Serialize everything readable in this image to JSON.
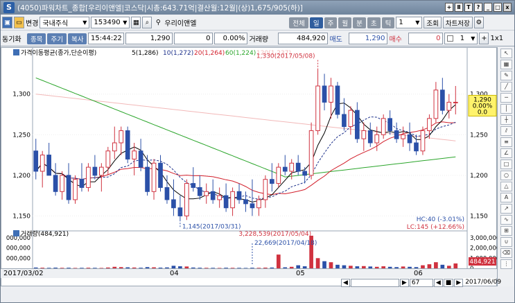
{
  "title": {
    "app_icon": "S",
    "text": "(4050)파워차트_종합[우리이앤엘|코스닥|시총:643.71억|결산월:12월|(상)1,675/905(하)]",
    "buttons": [
      "+",
      "Ⅱ",
      "T",
      "?",
      "_",
      "□",
      "x"
    ]
  },
  "toolbar1": {
    "change_label": "변경",
    "market": "국내주식",
    "code": "153490",
    "stock_name": "우리이앤엘",
    "view_buttons": [
      "전체",
      "일",
      "주",
      "월",
      "분",
      "초",
      "틱"
    ],
    "view_selected": "일",
    "period_value": "1",
    "query_button": "조회",
    "save_button": "차트저장"
  },
  "toolbar2": {
    "sync_label": "동기화",
    "tabs": [
      "종목",
      "주기",
      "복사"
    ],
    "time": "15:44:22",
    "price": "1,290",
    "change": "0",
    "change_pct": "0.00%",
    "volume_label": "거래량",
    "volume": "484,920",
    "ask_label": "매도",
    "ask": "1,290",
    "bid_label": "매수",
    "bid": "0",
    "count": "1",
    "ratio_label": "1x1"
  },
  "legend": {
    "ma_title": "가격이동평균(종가,단순이평)",
    "ma5": "5(1,286)",
    "ma10": "10(1,272)",
    "ma20": "20(1,264)",
    "ma60": "60(1,224)",
    "ma120": "120(1,237)",
    "volume_title": "거래량(484,921)"
  },
  "annotations": {
    "high": "1,330(2017/05/08)",
    "low": "1,145(2017/03/31)",
    "vol_high": "3,228,539(2017/05/04)",
    "vol_low": "22,669(2017/04/18)",
    "hc": "HC:40 (-3.01%)",
    "lc": "LC:145 (+12.66%)",
    "last_price": "1,290",
    "last_pct": "0.00%",
    "last_chg": "0.0",
    "last_vol": "484,921"
  },
  "axis": {
    "price_ticks": [
      "1,300",
      "1,250",
      "1,200",
      "1,150"
    ],
    "vol_ticks": [
      "3,000,000",
      "2,000,000",
      "1,000,000",
      "0"
    ],
    "left_vol_ticks": [
      "000,000",
      "000,000",
      "000,000"
    ],
    "dates": [
      "2017/03/02",
      "04",
      "05",
      "06",
      "2017/06/09"
    ]
  },
  "bottom": {
    "zoom": "67"
  },
  "colors": {
    "up": "#d0323f",
    "down": "#2b50a8",
    "ma5": "#000000",
    "ma10": "#1b2f8a",
    "ma20": "#d21e2a",
    "ma60": "#2aa52a",
    "ma120": "#f2b8b8"
  },
  "chart_data": {
    "type": "candlestick",
    "ylim": [
      1135,
      1345
    ],
    "candles": [
      [
        1230,
        1245,
        1195,
        1205
      ],
      [
        1205,
        1230,
        1185,
        1225
      ],
      [
        1225,
        1240,
        1200,
        1200
      ],
      [
        1200,
        1215,
        1175,
        1180
      ],
      [
        1180,
        1205,
        1170,
        1200
      ],
      [
        1200,
        1215,
        1165,
        1170
      ],
      [
        1170,
        1200,
        1165,
        1195
      ],
      [
        1195,
        1215,
        1180,
        1185
      ],
      [
        1185,
        1215,
        1180,
        1210
      ],
      [
        1210,
        1225,
        1195,
        1200
      ],
      [
        1200,
        1215,
        1180,
        1210
      ],
      [
        1210,
        1235,
        1200,
        1230
      ],
      [
        1230,
        1260,
        1220,
        1240
      ],
      [
        1240,
        1260,
        1225,
        1255
      ],
      [
        1255,
        1260,
        1215,
        1220
      ],
      [
        1220,
        1240,
        1200,
        1230
      ],
      [
        1230,
        1245,
        1205,
        1210
      ],
      [
        1210,
        1225,
        1175,
        1180
      ],
      [
        1180,
        1220,
        1170,
        1215
      ],
      [
        1215,
        1225,
        1180,
        1185
      ],
      [
        1185,
        1200,
        1165,
        1170
      ],
      [
        1170,
        1195,
        1150,
        1160
      ],
      [
        1160,
        1175,
        1145,
        1150
      ],
      [
        1150,
        1195,
        1145,
        1190
      ],
      [
        1190,
        1210,
        1180,
        1185
      ],
      [
        1185,
        1200,
        1170,
        1175
      ],
      [
        1175,
        1190,
        1165,
        1180
      ],
      [
        1180,
        1195,
        1165,
        1170
      ],
      [
        1170,
        1185,
        1160,
        1175
      ],
      [
        1175,
        1190,
        1155,
        1160
      ],
      [
        1160,
        1185,
        1150,
        1180
      ],
      [
        1180,
        1190,
        1165,
        1170
      ],
      [
        1170,
        1180,
        1155,
        1165
      ],
      [
        1165,
        1195,
        1150,
        1160
      ],
      [
        1160,
        1175,
        1150,
        1170
      ],
      [
        1170,
        1200,
        1160,
        1195
      ],
      [
        1195,
        1215,
        1180,
        1190
      ],
      [
        1190,
        1215,
        1185,
        1210
      ],
      [
        1210,
        1225,
        1200,
        1205
      ],
      [
        1205,
        1220,
        1195,
        1215
      ],
      [
        1215,
        1225,
        1200,
        1205
      ],
      [
        1205,
        1210,
        1190,
        1200
      ],
      [
        1200,
        1265,
        1195,
        1255
      ],
      [
        1255,
        1330,
        1250,
        1310
      ],
      [
        1310,
        1325,
        1280,
        1290
      ],
      [
        1290,
        1320,
        1270,
        1310
      ],
      [
        1310,
        1315,
        1270,
        1275
      ],
      [
        1275,
        1295,
        1255,
        1260
      ],
      [
        1260,
        1285,
        1250,
        1280
      ],
      [
        1280,
        1290,
        1240,
        1245
      ],
      [
        1245,
        1265,
        1230,
        1255
      ],
      [
        1255,
        1265,
        1235,
        1240
      ],
      [
        1240,
        1260,
        1230,
        1250
      ],
      [
        1250,
        1275,
        1245,
        1270
      ],
      [
        1270,
        1280,
        1250,
        1255
      ],
      [
        1255,
        1265,
        1240,
        1245
      ],
      [
        1245,
        1260,
        1235,
        1250
      ],
      [
        1250,
        1265,
        1230,
        1240
      ],
      [
        1240,
        1250,
        1225,
        1230
      ],
      [
        1230,
        1260,
        1225,
        1255
      ],
      [
        1255,
        1275,
        1245,
        1270
      ],
      [
        1270,
        1315,
        1265,
        1305
      ],
      [
        1305,
        1320,
        1275,
        1280
      ],
      [
        1280,
        1300,
        1270,
        1290
      ],
      [
        1290,
        1310,
        1275,
        1290
      ]
    ],
    "volumes": [
      0.08,
      0.06,
      0.05,
      0.07,
      0.05,
      0.06,
      0.04,
      0.05,
      0.06,
      0.05,
      0.04,
      0.08,
      0.15,
      0.12,
      0.1,
      0.08,
      0.06,
      0.12,
      0.1,
      0.07,
      0.09,
      0.25,
      0.2,
      0.18,
      0.08,
      0.06,
      0.05,
      0.05,
      0.04,
      0.06,
      0.05,
      0.05,
      0.04,
      0.06,
      0.05,
      0.07,
      0.08,
      1.35,
      0.1,
      0.15,
      0.3,
      0.2,
      3.2,
      1.0,
      0.7,
      0.6,
      0.35,
      0.3,
      0.25,
      0.2,
      0.22,
      0.18,
      0.15,
      0.2,
      0.15,
      0.12,
      0.18,
      0.15,
      0.12,
      0.3,
      0.4,
      0.6,
      0.35,
      0.25,
      0.48
    ],
    "vol_ylim": [
      0,
      3400000
    ]
  }
}
